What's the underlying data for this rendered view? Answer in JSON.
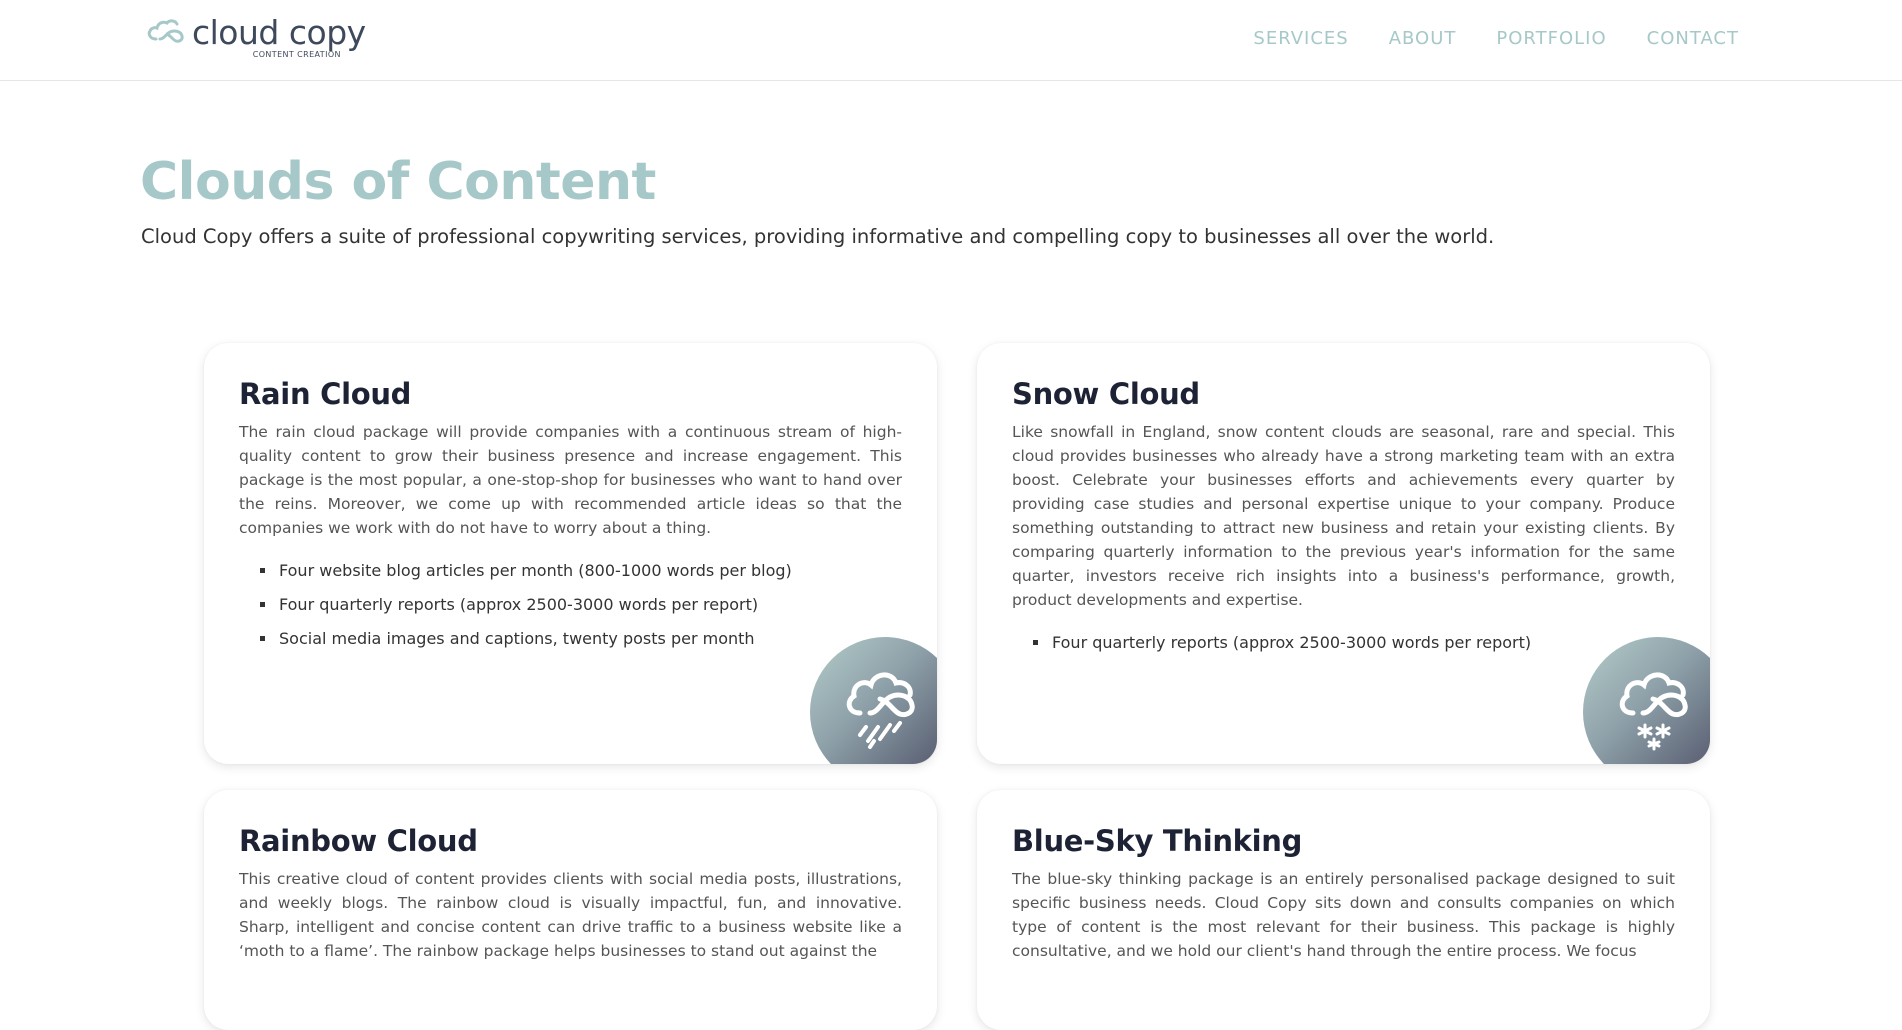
{
  "header": {
    "logo": {
      "title": "cloud copy",
      "subtitle": "CONTENT CREATION",
      "icon": "cloud-logo-icon"
    },
    "nav": [
      {
        "label": "SERVICES"
      },
      {
        "label": "ABOUT"
      },
      {
        "label": "PORTFOLIO"
      },
      {
        "label": "CONTACT"
      }
    ]
  },
  "hero": {
    "title": "Clouds of Content",
    "subtitle": "Cloud Copy offers a suite of professional copywriting services, providing informative and compelling copy to businesses all over the world."
  },
  "cards": [
    {
      "title": "Rain Cloud",
      "body": "The rain cloud package will provide companies with a continuous stream of high-quality content to grow their business presence and increase engagement. This package is the most popular, a one-stop-shop for businesses who want to hand over the reins. Moreover, we come up with recommended article ideas so that the companies we work with do not have to worry about a thing.",
      "items": [
        "Four website blog articles per month (800-1000 words per blog)",
        "Four quarterly reports (approx 2500-3000 words per report)",
        "Social media images and captions, twenty posts per month"
      ],
      "icon": "rain-cloud-icon"
    },
    {
      "title": "Snow Cloud",
      "body": "Like snowfall in England, snow content clouds are seasonal, rare and special. This cloud provides businesses who already have a strong marketing team with an extra boost. Celebrate your businesses efforts and achievements every quarter by providing case studies and personal expertise unique to your company. Produce something outstanding to attract new business and retain your existing clients. By comparing quarterly information to the previous year's information for the same quarter, investors receive rich insights into a business's performance, growth, product developments and expertise.",
      "items": [
        "Four quarterly reports (approx 2500-3000 words per report)"
      ],
      "icon": "snow-cloud-icon"
    },
    {
      "title": "Rainbow Cloud",
      "body": "This creative cloud of content provides clients with social media posts, illustrations, and weekly blogs. The rainbow cloud is visually impactful, fun, and innovative. Sharp, intelligent and concise content can drive traffic to a business website like a ‘moth to a flame’. The rainbow package helps businesses to stand out against the"
    },
    {
      "title": "Blue-Sky Thinking",
      "body": "The blue-sky thinking package is an entirely personalised package designed to suit specific business needs. Cloud Copy sits down and consults companies on which type of content is the most relevant for their business. This package is highly consultative, and we hold our client's hand through the entire process. We focus"
    }
  ],
  "colors": {
    "accent": "#a6c8c8",
    "heading": "#1e2235",
    "text": "#555555"
  }
}
